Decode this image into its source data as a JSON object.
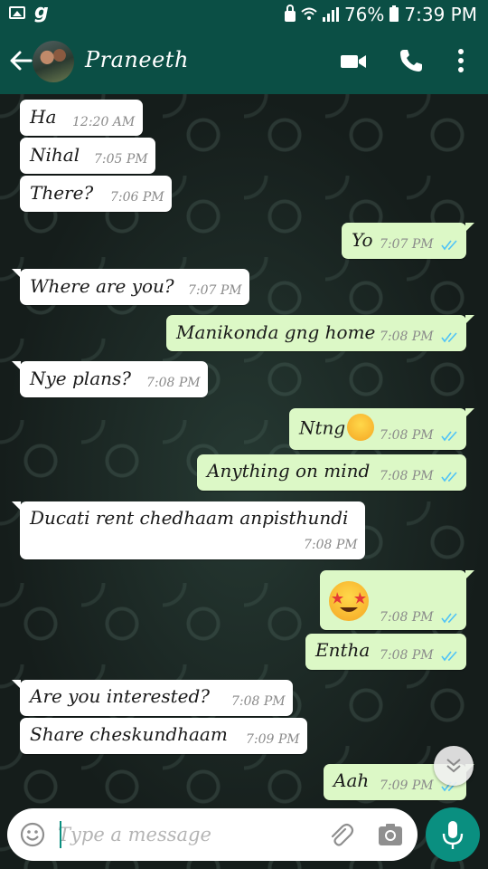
{
  "status_bar": {
    "battery": "76%",
    "time": "7:39 PM",
    "icons": [
      "gallery-icon",
      "g-app-icon",
      "lock-icon",
      "wifi-icon",
      "signal-icon",
      "battery-icon"
    ]
  },
  "header": {
    "contact_name": "Praneeth",
    "icons": [
      "back-arrow-icon",
      "video-call-icon",
      "phone-icon",
      "more-vertical-icon"
    ]
  },
  "messages": [
    {
      "dir": "in",
      "text": "Ha",
      "time": "12:20 AM"
    },
    {
      "dir": "in",
      "text": "Nihal",
      "time": "7:05 PM"
    },
    {
      "dir": "in",
      "text": "There?",
      "time": "7:06 PM"
    },
    {
      "dir": "out",
      "text": "Yo",
      "time": "7:07 PM",
      "ticks": "read"
    },
    {
      "dir": "in",
      "text": "Where are you?",
      "time": "7:07 PM"
    },
    {
      "dir": "out",
      "text": "Manikonda gng home",
      "time": "7:08 PM",
      "ticks": "read"
    },
    {
      "dir": "in",
      "text": "Nye plans?",
      "time": "7:08 PM"
    },
    {
      "dir": "out",
      "text": "Ntng",
      "emoji": "disappointed-face",
      "time": "7:08 PM",
      "ticks": "read"
    },
    {
      "dir": "out",
      "text": "Anything on mind",
      "time": "7:08 PM",
      "ticks": "read"
    },
    {
      "dir": "in",
      "text": "Ducati rent chedhaam anpisthundi",
      "time": "7:08 PM"
    },
    {
      "dir": "out",
      "emoji": "star-struck",
      "time": "7:08 PM",
      "ticks": "read"
    },
    {
      "dir": "out",
      "text": "Entha",
      "time": "7:08 PM",
      "ticks": "read"
    },
    {
      "dir": "in",
      "text": "Are you interested?",
      "time": "7:08 PM"
    },
    {
      "dir": "in",
      "text": "Share cheskundhaam",
      "time": "7:09 PM"
    },
    {
      "dir": "out",
      "text": "Aah",
      "time": "7:09 PM",
      "ticks": "read"
    }
  ],
  "composer": {
    "placeholder": "Type a message",
    "value": ""
  },
  "colors": {
    "header": "#0b4f45",
    "incoming_bubble": "#ffffff",
    "outgoing_bubble": "#dcf8c6",
    "read_ticks": "#4fc3f7",
    "mic_button": "#0a8f80"
  }
}
